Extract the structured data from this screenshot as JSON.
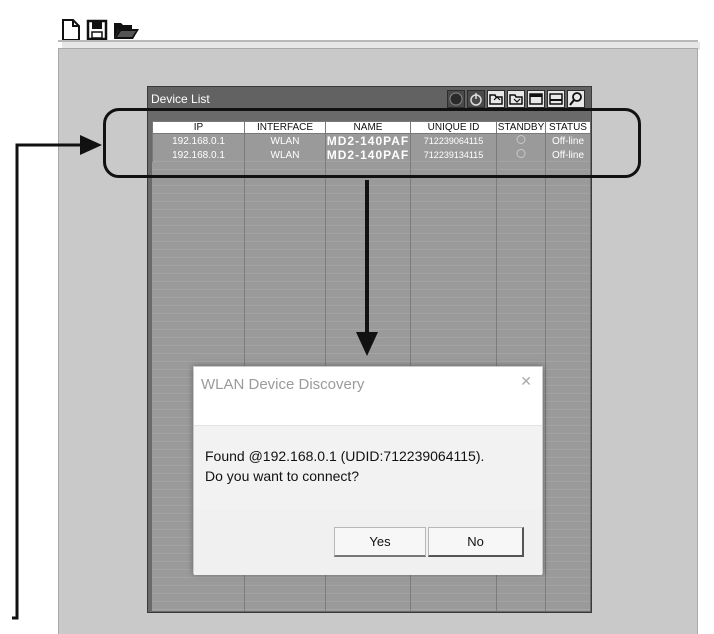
{
  "toolbar": {
    "icons": [
      "new-file-icon",
      "save-icon",
      "open-folder-icon"
    ]
  },
  "device_list": {
    "title": "Device List",
    "toolbar_icons": [
      "stop-icon",
      "power-icon",
      "folder-up-icon",
      "folder-down-icon",
      "panel-icon",
      "panel-alt-icon",
      "search-icon"
    ],
    "columns": [
      "IP",
      "INTERFACE",
      "NAME",
      "UNIQUE ID",
      "STANDBY",
      "STATUS"
    ],
    "rows": [
      {
        "ip": "192.168.0.1",
        "interface": "WLAN",
        "name": "MD2-140PAF",
        "unique_id": "712239064115",
        "standby": "",
        "status": "Off-line"
      },
      {
        "ip": "192.168.0.1",
        "interface": "WLAN",
        "name": "MD2-140PAF",
        "unique_id": "712239134115",
        "standby": "",
        "status": "Off-line"
      }
    ]
  },
  "dialog": {
    "title": "WLAN Device Discovery",
    "message_line1": "Found @192.168.0.1 (UDID:712239064115).",
    "message_line2": "Do you want to connect?",
    "yes_label": "Yes",
    "no_label": "No"
  }
}
